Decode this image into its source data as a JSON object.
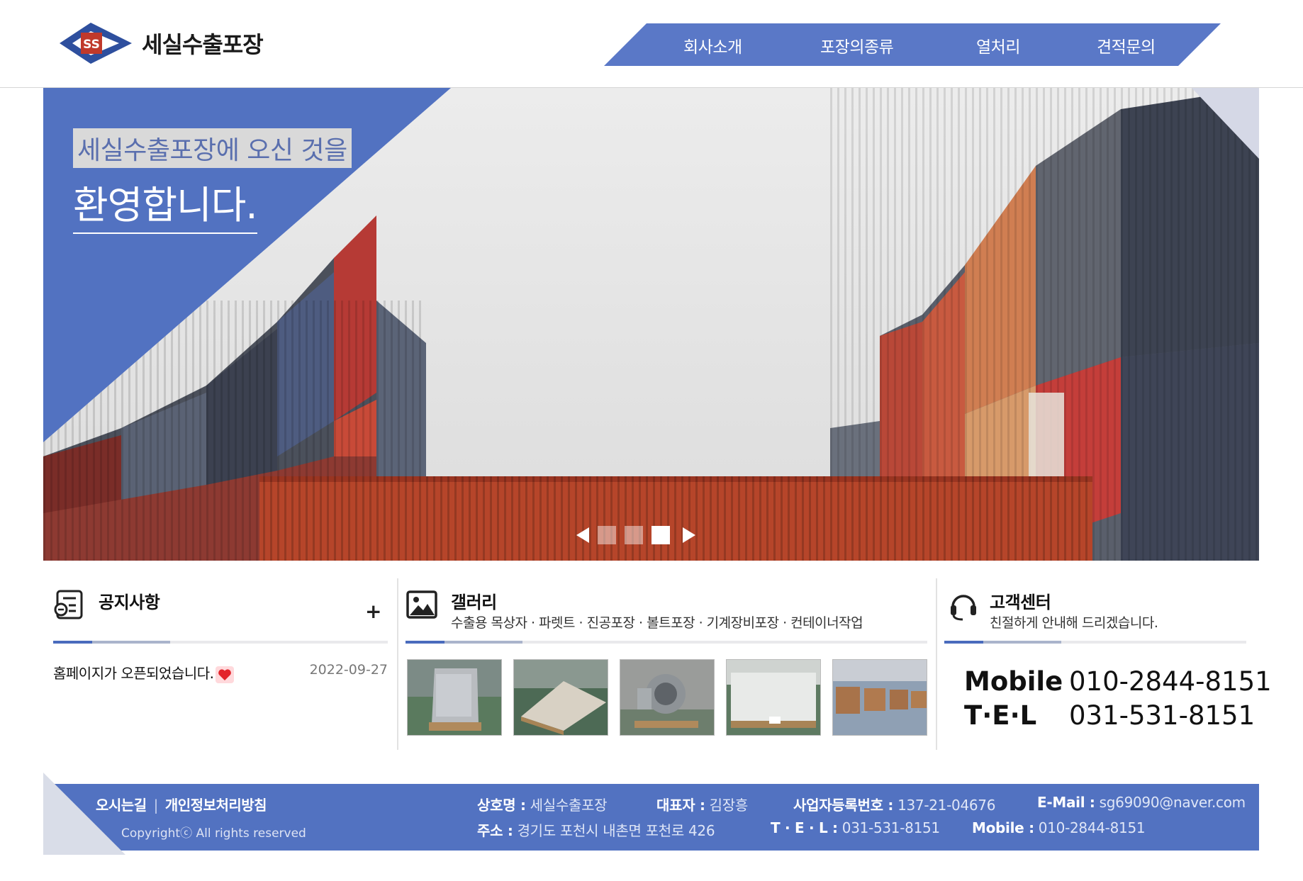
{
  "brand": {
    "name": "세실수출포장",
    "logo_mark": "SS",
    "colors": {
      "primary": "#5272c1",
      "nav": "#5a78c7",
      "logo_red": "#c0392b"
    }
  },
  "nav": {
    "items": [
      "회사소개",
      "포장의종류",
      "열처리",
      "견적문의"
    ]
  },
  "hero": {
    "line1": "세실수출포장에 오신 것을",
    "line2": "환영합니다.",
    "slides": 3,
    "active_slide": 3,
    "prev_icon": "arrow-left-icon",
    "next_icon": "arrow-right-icon"
  },
  "notice": {
    "title": "공지사항",
    "icon": "notice-icon",
    "more_label": "+",
    "items": [
      {
        "title": "홈페이지가 오픈되었습니다.",
        "date": "2022-09-27",
        "badge_icon": "heart-icon"
      }
    ]
  },
  "gallery": {
    "title": "갤러리",
    "icon": "image-icon",
    "subtitle": "수출용 목상자 · 파렛트 · 진공포장 · 볼트포장 · 기계장비포장 · 컨테이너작업",
    "thumbnails": 5
  },
  "support": {
    "title": "고객센터",
    "icon": "headset-icon",
    "subtitle": "친절하게 안내해 드리겠습니다.",
    "mobile_label": "Mobile",
    "mobile": "010-2844-8151",
    "tel_label": "T·E·L",
    "tel": "031-531-8151"
  },
  "footer": {
    "link_directions": "오시는길",
    "link_separator": "|",
    "link_privacy": "개인정보처리방침",
    "copyright": "Copyrightⓒ All rights reserved",
    "company_label": "상호명 :",
    "company": "세실수출포장",
    "ceo_label": "대표자 :",
    "ceo": "김장흥",
    "bizno_label": "사업자등록번호 :",
    "bizno": "137-21-04676",
    "email_label": "E-Mail :",
    "email": "sg69090@naver.com",
    "address_label": "주소 :",
    "address": "경기도 포천시 내촌면 포천로 426",
    "tel_label": "T · E · L :",
    "tel": "031-531-8151",
    "mobile_label": "Mobile :",
    "mobile": "010-2844-8151"
  }
}
